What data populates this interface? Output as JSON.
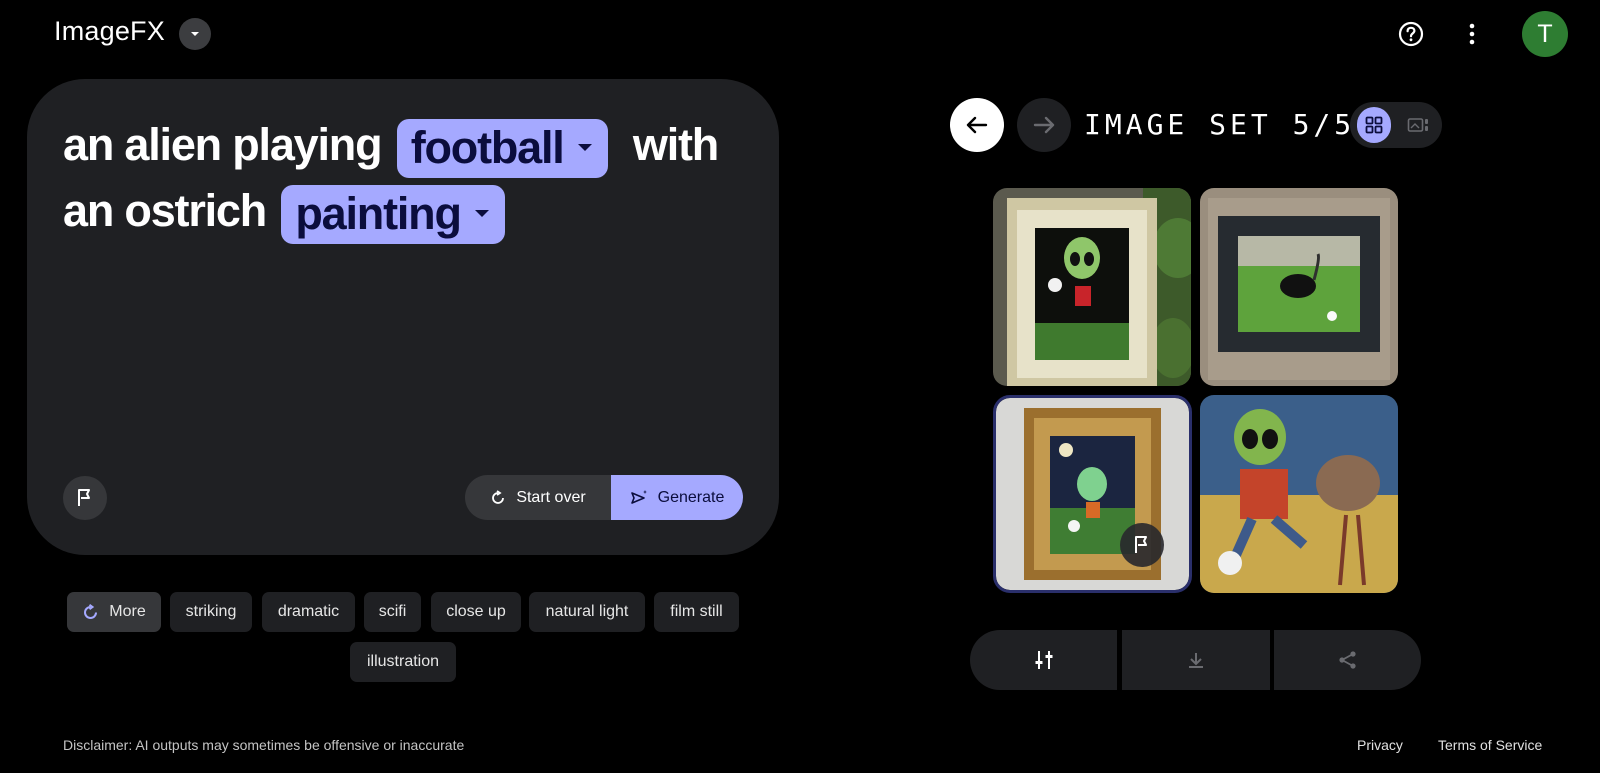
{
  "app": {
    "title": "ImageFX"
  },
  "header": {
    "avatar_letter": "T"
  },
  "prompt": {
    "part1": "an alien playing",
    "chip1": "football",
    "part2": "with",
    "part3": "an ostrich",
    "chip2": "painting"
  },
  "actions": {
    "start_over": "Start over",
    "generate": "Generate"
  },
  "styles": {
    "more": "More",
    "items": [
      "striking",
      "dramatic",
      "scifi",
      "close up",
      "natural light",
      "film still",
      "illustration"
    ]
  },
  "image_set": {
    "label": "IMAGE SET 5/5",
    "view": "grid"
  },
  "footer": {
    "disclaimer": "Disclaimer: AI outputs may sometimes be offensive or inaccurate",
    "privacy": "Privacy",
    "terms": "Terms of Service"
  },
  "colors": {
    "accent": "#a5a9ff",
    "surface": "#1f2023",
    "avatar": "#2e7d32"
  }
}
